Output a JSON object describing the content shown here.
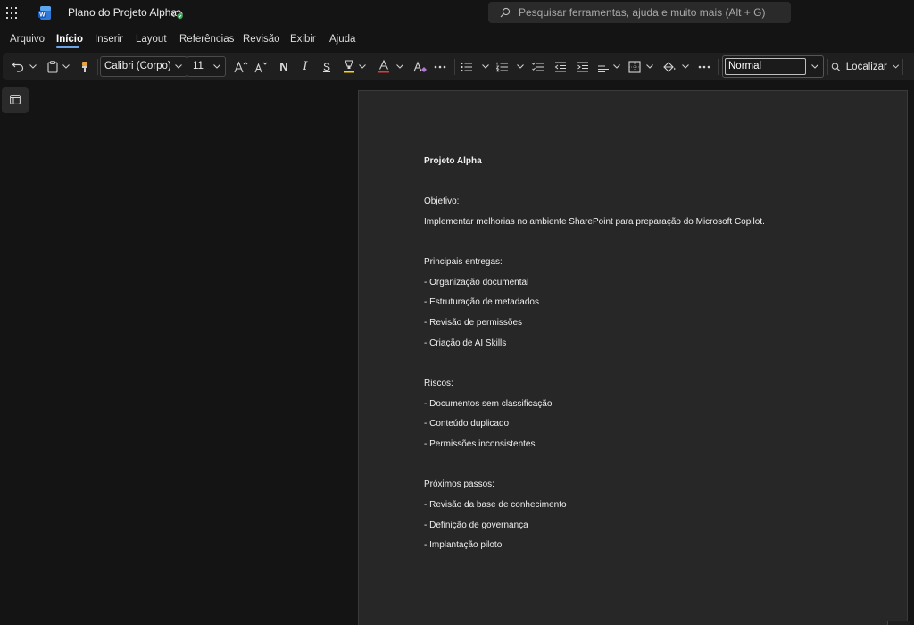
{
  "titlebar": {
    "doc_title": "Plano do Projeto Alpha",
    "search_placeholder": "Pesquisar ferramentas, ajuda e muito mais (Alt + G)",
    "icons": [
      "app-launcher-icon",
      "word-logo-icon",
      "cloud-saved-icon",
      "search-icon"
    ]
  },
  "menu": {
    "items": [
      "Arquivo",
      "Início",
      "Inserir",
      "Layout",
      "Referências",
      "Revisão",
      "Exibir",
      "Ajuda"
    ],
    "active": "Início"
  },
  "ribbon": {
    "font_name": "Calibri (Corpo)",
    "font_size": "11",
    "bold_glyph": "N",
    "italic_glyph": "I",
    "underline_glyph": "S",
    "style_name": "Normal",
    "find_label": "Localizar",
    "highlight_color": "#ffd400",
    "font_color": "#e03a3a",
    "accent_color": "#6aa3e8"
  },
  "document": {
    "lines": [
      {
        "text": "Projeto Alpha",
        "bold": true
      },
      {
        "text": ""
      },
      {
        "text": "Objetivo:"
      },
      {
        "text": "Implementar melhorias no ambiente SharePoint para preparação do Microsoft Copilot."
      },
      {
        "text": ""
      },
      {
        "text": "Principais entregas:"
      },
      {
        "text": "- Organização documental"
      },
      {
        "text": "- Estruturação de metadados"
      },
      {
        "text": "- Revisão de permissões"
      },
      {
        "text": "- Criação de AI Skills"
      },
      {
        "text": ""
      },
      {
        "text": "Riscos:"
      },
      {
        "text": "- Documentos sem classificação"
      },
      {
        "text": "- Conteúdo duplicado"
      },
      {
        "text": "- Permissões inconsistentes"
      },
      {
        "text": ""
      },
      {
        "text": "Próximos passos:"
      },
      {
        "text": "- Revisão da base de conhecimento"
      },
      {
        "text": "- Definição de governança"
      },
      {
        "text": "- Implantação piloto"
      }
    ]
  }
}
